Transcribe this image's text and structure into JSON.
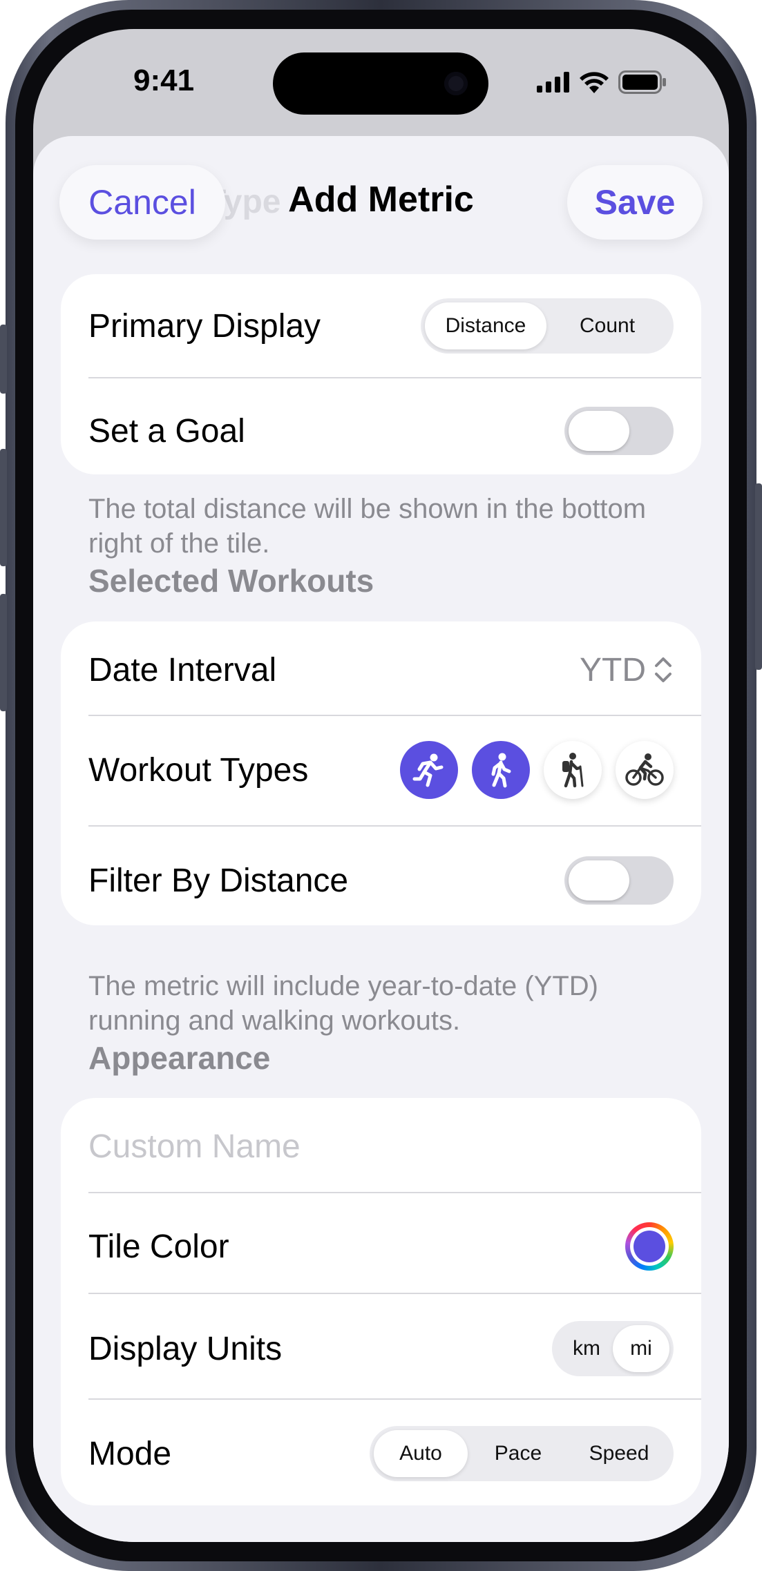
{
  "status_bar": {
    "time": "9:41"
  },
  "nav": {
    "cancel_label": "Cancel",
    "title": "Add Metric",
    "save_label": "Save",
    "ghost_text": "Type"
  },
  "display_card": {
    "primary_display": {
      "label": "Primary Display",
      "options": [
        "Distance",
        "Count"
      ],
      "selected": "Distance"
    },
    "set_goal": {
      "label": "Set a Goal",
      "on": false
    }
  },
  "display_footnote": "The total distance will be shown in the bottom right of the tile.",
  "workouts_header": "Selected Workouts",
  "workouts_card": {
    "date_interval": {
      "label": "Date Interval",
      "value": "YTD"
    },
    "workout_types": {
      "label": "Workout Types",
      "items": [
        {
          "name": "running",
          "selected": true
        },
        {
          "name": "walking",
          "selected": true
        },
        {
          "name": "hiking",
          "selected": false
        },
        {
          "name": "cycling",
          "selected": false
        }
      ]
    },
    "filter_distance": {
      "label": "Filter By Distance",
      "on": false
    }
  },
  "workouts_footnote": "The metric will include year-to-date (YTD) running and walking workouts.",
  "appearance_header": "Appearance",
  "appearance_card": {
    "custom_name": {
      "placeholder": "Custom Name"
    },
    "tile_color": {
      "label": "Tile Color",
      "color": "#5b4fe0"
    },
    "display_units": {
      "label": "Display Units",
      "options": [
        "km",
        "mi"
      ],
      "selected": "mi"
    },
    "mode": {
      "label": "Mode",
      "options": [
        "Auto",
        "Pace",
        "Speed"
      ],
      "selected": "Auto"
    }
  },
  "colors": {
    "accent": "#5b4fe0",
    "background": "#f2f2f7",
    "secondary_text": "#8a8a90"
  }
}
